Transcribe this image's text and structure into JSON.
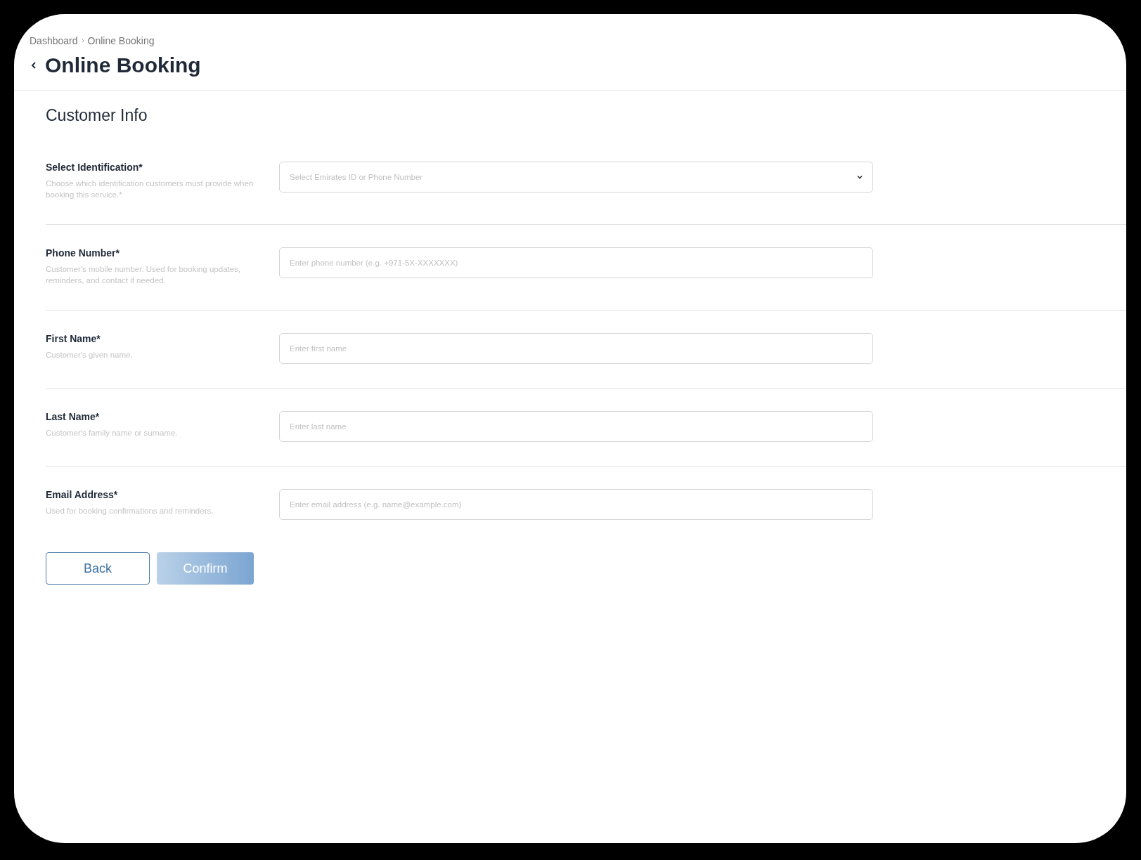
{
  "breadcrumb": [
    "Dashboard",
    "Online Booking"
  ],
  "page_title": "Online Booking",
  "section_title": "Customer Info",
  "fields": [
    {
      "kind": "select",
      "label": "Select Identification*",
      "description": "Choose which identification customers must provide when booking this service.*",
      "placeholder": "Select Emirates ID or Phone Number"
    },
    {
      "kind": "text",
      "label": "Phone Number*",
      "description": "Customer's mobile number. Used for booking updates, reminders, and contact if needed.",
      "placeholder": "Enter phone number (e.g. +971-5X-XXXXXXX)"
    },
    {
      "kind": "text",
      "label": "First Name*",
      "description": "Customer's given name.",
      "placeholder": "Enter first name"
    },
    {
      "kind": "text",
      "label": "Last Name*",
      "description": "Customer's family name or surname.",
      "placeholder": "Enter last name"
    },
    {
      "kind": "text",
      "label": "Email Address*",
      "description": "Used for booking confirmations and reminders.",
      "placeholder": "Enter email address (e.g. name@example.com)"
    }
  ],
  "buttons": [
    {
      "kind": "secondary",
      "label": "Back",
      "disabled": false
    },
    {
      "kind": "primary",
      "label": "Confirm",
      "disabled": true
    }
  ]
}
